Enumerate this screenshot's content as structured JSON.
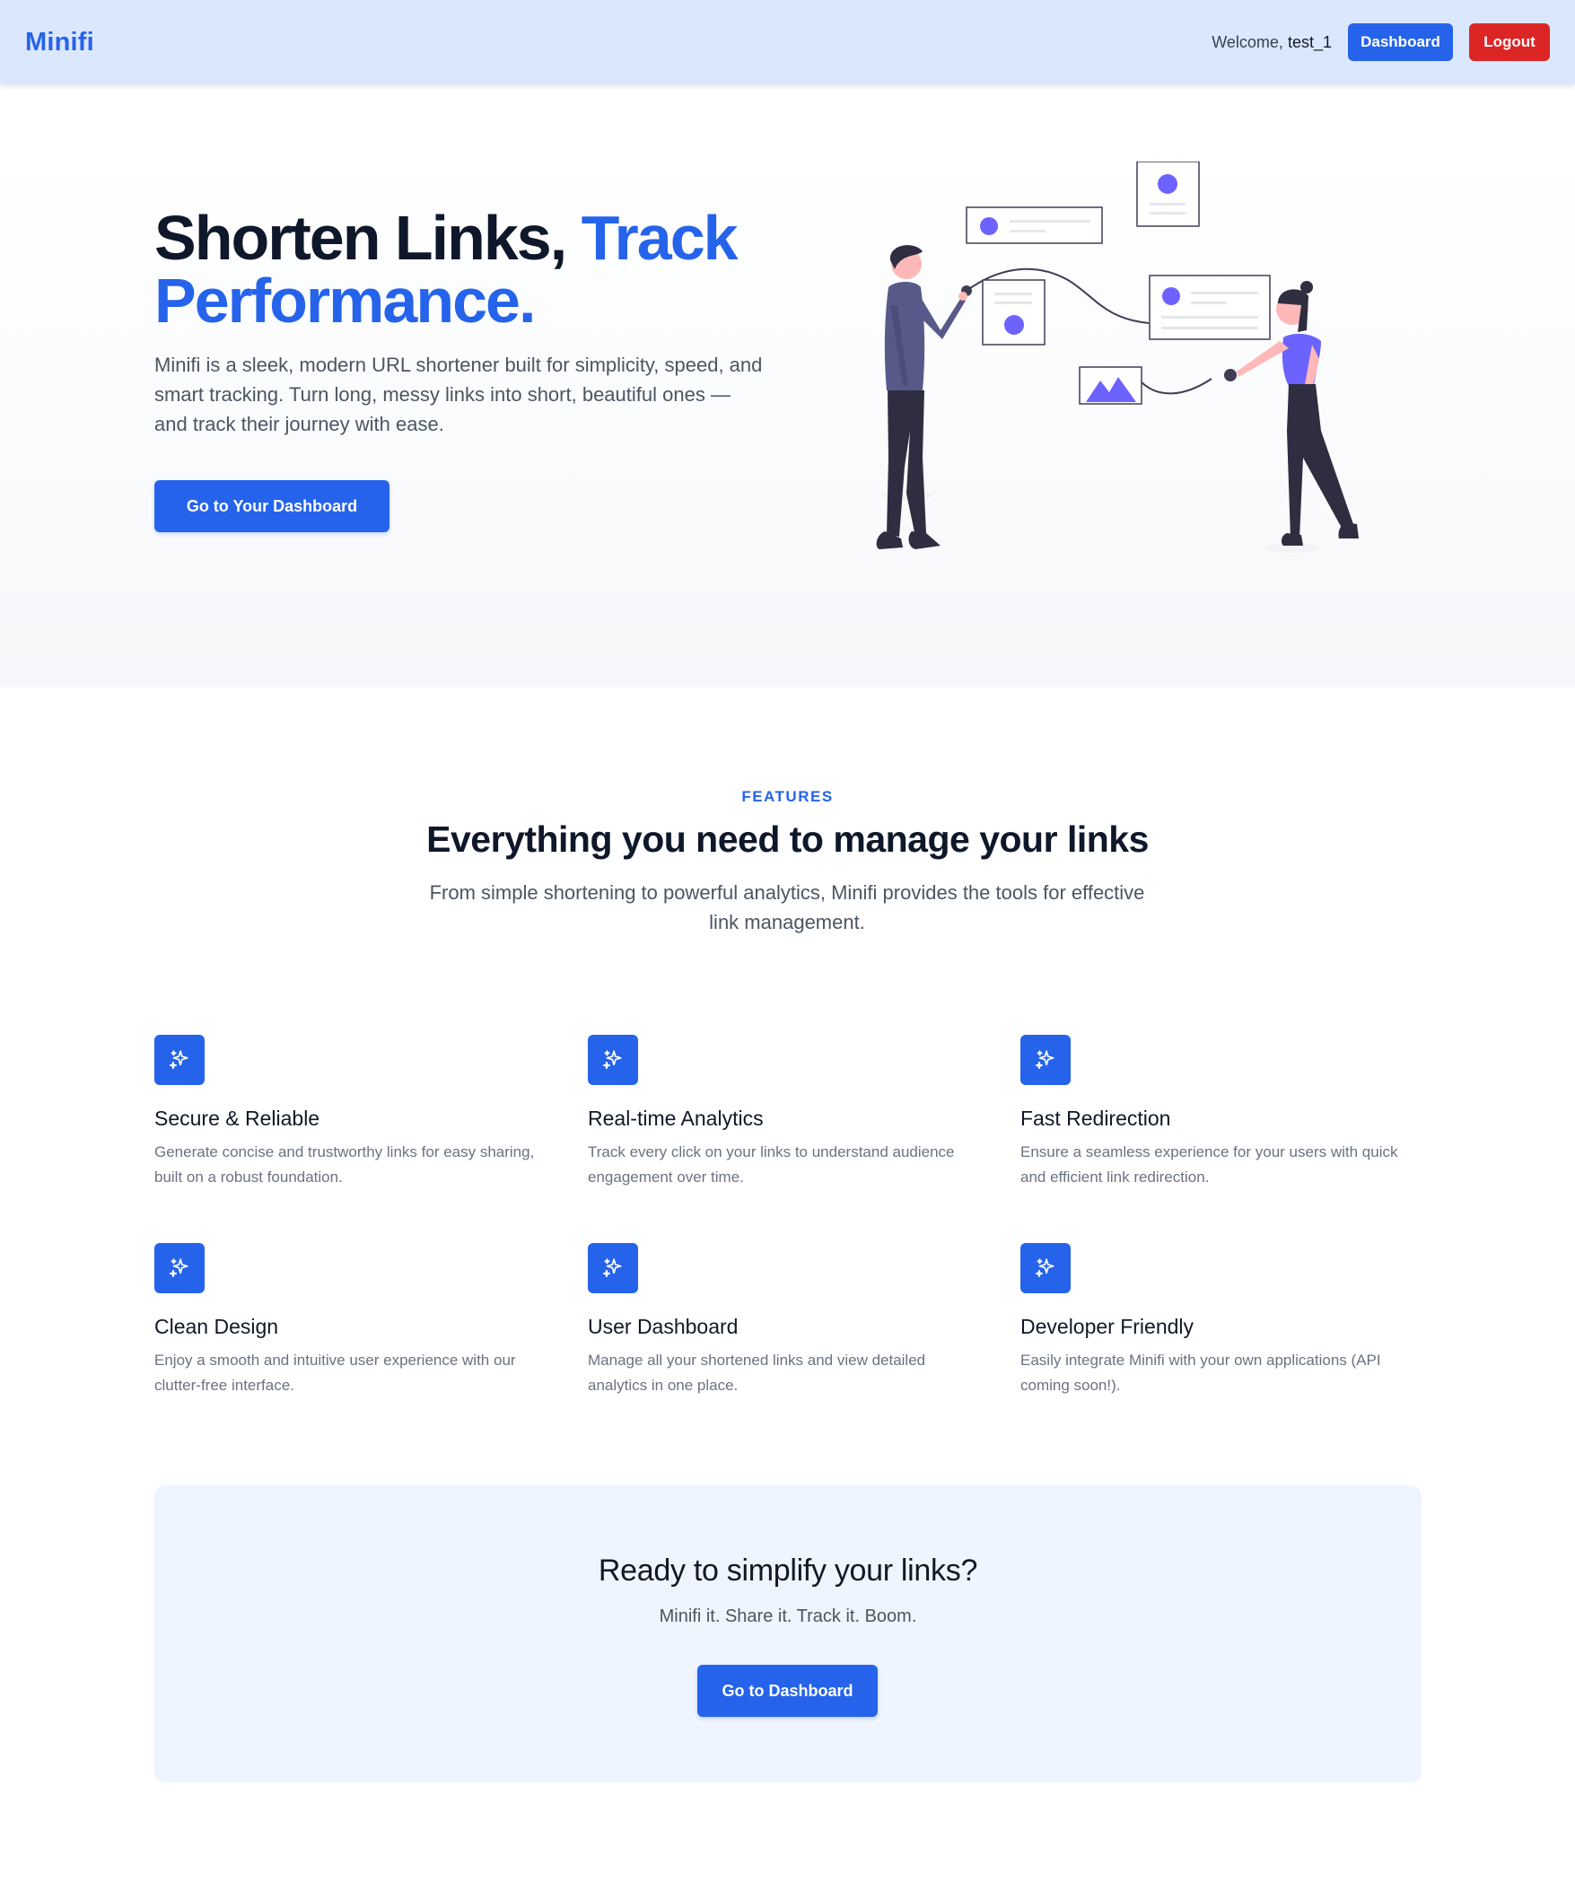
{
  "nav": {
    "logo": "Minifi",
    "welcome_prefix": "Welcome,",
    "username": "test_1",
    "dashboard_label": "Dashboard",
    "logout_label": "Logout"
  },
  "hero": {
    "title_part1": "Shorten Links, ",
    "title_accent": "Track Performance.",
    "description": "Minifi is a sleek, modern URL shortener built for simplicity, speed, and smart tracking. Turn long, messy links into short, beautiful ones — and track their journey with ease.",
    "cta_label": "Go to Your Dashboard"
  },
  "features": {
    "eyebrow": "FEATURES",
    "title": "Everything you need to manage your links",
    "subtitle": "From simple shortening to powerful analytics, Minifi provides the tools for effective link management.",
    "items": [
      {
        "icon": "sparkles-icon",
        "title": "Secure & Reliable",
        "desc": "Generate concise and trustworthy links for easy sharing, built on a robust foundation."
      },
      {
        "icon": "sparkles-icon",
        "title": "Real-time Analytics",
        "desc": "Track every click on your links to understand audience engagement over time."
      },
      {
        "icon": "sparkles-icon",
        "title": "Fast Redirection",
        "desc": "Ensure a seamless experience for your users with quick and efficient link redirection."
      },
      {
        "icon": "sparkles-icon",
        "title": "Clean Design",
        "desc": "Enjoy a smooth and intuitive user experience with our clutter-free interface."
      },
      {
        "icon": "sparkles-icon",
        "title": "User Dashboard",
        "desc": "Manage all your shortened links and view detailed analytics in one place."
      },
      {
        "icon": "sparkles-icon",
        "title": "Developer Friendly",
        "desc": "Easily integrate Minifi with your own applications (API coming soon!)."
      }
    ]
  },
  "cta": {
    "title": "Ready to simplify your links?",
    "subtitle": "Minifi it. Share it. Track it. Boom.",
    "button_label": "Go to Dashboard"
  },
  "colors": {
    "primary": "#2563eb",
    "danger": "#dc2626",
    "nav_bg": "#dbe7fd",
    "cta_bg": "#eff5fe",
    "illustration_accent": "#6c63ff"
  }
}
